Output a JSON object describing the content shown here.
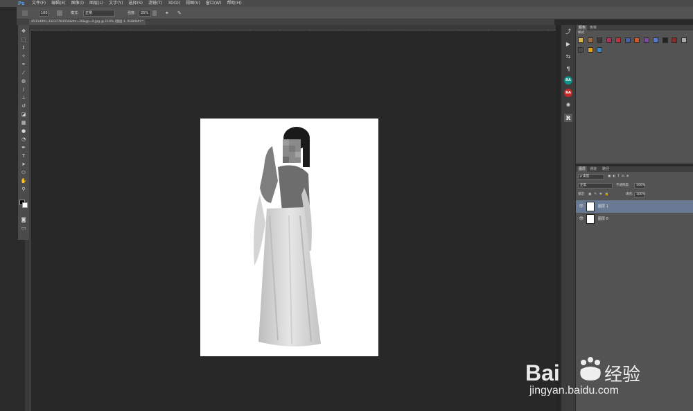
{
  "app": {
    "logo": "Ps"
  },
  "menu": [
    "文件(F)",
    "编辑(E)",
    "图像(I)",
    "图层(L)",
    "文字(Y)",
    "选择(S)",
    "滤镜(T)",
    "3D(D)",
    "视图(V)",
    "窗口(W)",
    "帮助(H)"
  ],
  "options": {
    "brush_size": "100",
    "mode_label": "模式:",
    "mode_value": "正常",
    "strength_label": "强度:",
    "strength_value": "25%"
  },
  "document": {
    "tab_title": "45114091,33237763556&fm=26&gp=0.jpg @ 110% (图层 1, RGB/8#) *"
  },
  "ruler_ticks": [
    "10",
    "8",
    "6",
    "4",
    "2",
    "0",
    "2",
    "4",
    "6",
    "8",
    "10",
    "12",
    "14",
    "16",
    "18",
    "20",
    "22",
    "24"
  ],
  "right_strip": {
    "ra1": "RA",
    "ra2": "RA",
    "r": "R"
  },
  "top_panel": {
    "tabs": [
      "颜色",
      "色板"
    ],
    "section_label": "样式"
  },
  "layers_panel": {
    "tabs": [
      "图层",
      "通道",
      "路径"
    ],
    "filter_kind": "ρ 类型",
    "blend_mode": "正常",
    "opacity_label": "不透明度:",
    "opacity_value": "100%",
    "lock_label": "锁定:",
    "fill_label": "填充:",
    "fill_value": "100%",
    "layers": [
      {
        "name": "图层 1",
        "selected": true
      },
      {
        "name": "图层 0",
        "selected": false
      }
    ]
  },
  "watermark": {
    "brand": "Bai",
    "brand_cn": "经验",
    "url": "jingyan.baidu.com"
  },
  "colors": {
    "ps_blue": "#4fa3ff",
    "selected_layer": "#687a94",
    "ra_teal": "#0f8f86",
    "ra_red": "#c62828"
  }
}
